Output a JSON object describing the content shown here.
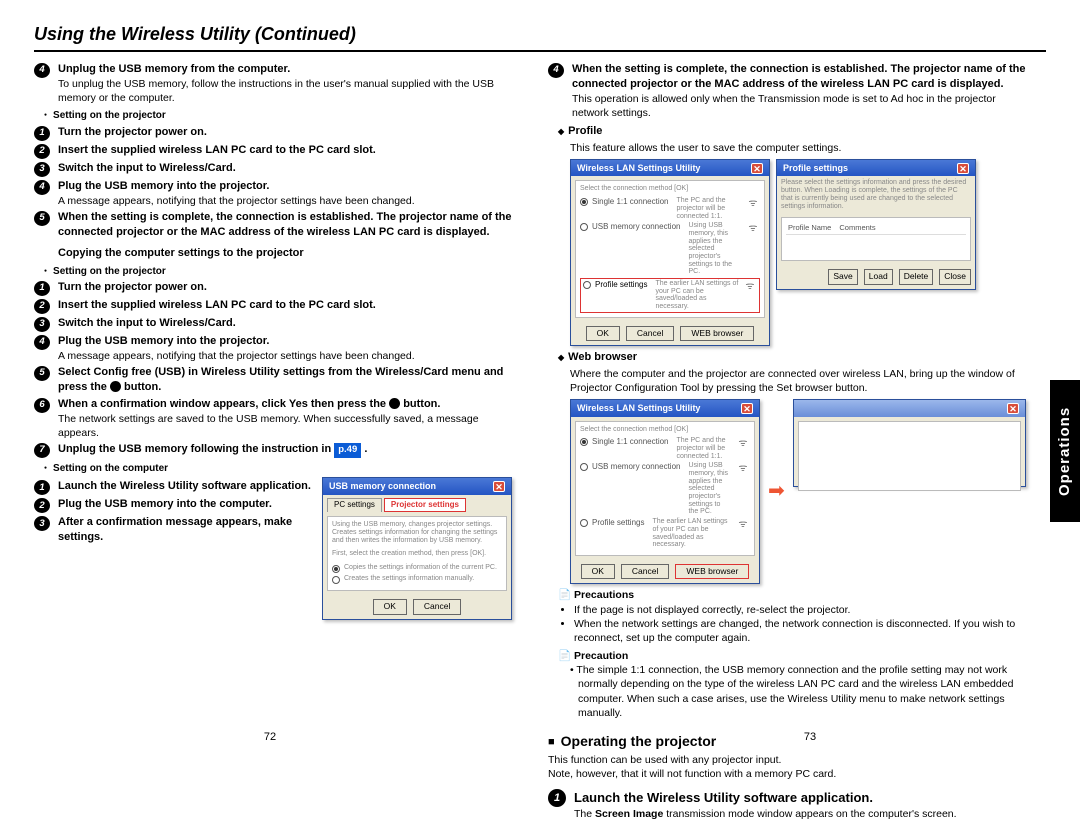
{
  "title": "Using the Wireless Utility (Continued)",
  "side_tab": "Operations",
  "page_left": "72",
  "page_right": "73",
  "left": {
    "s4_title": "Unplug the USB memory from the computer.",
    "s4_body": "To unplug the USB memory, follow the instructions in the user's manual supplied with the USB memory or the computer.",
    "setting_projector": "Setting on the projector",
    "p1": "Turn the projector power on.",
    "p2": "Insert the supplied wireless LAN PC card to the PC card slot.",
    "p3": "Switch the input to Wireless/Card.",
    "p4": "Plug the USB memory into the projector.",
    "p4_body": "A message appears, notifying that the projector settings have been changed.",
    "p5": "When the setting is complete, the connection is established. The projector name of the connected projector or the MAC address of the wireless LAN PC card is displayed.",
    "copy_title": "Copying the computer settings to the projector",
    "c5": "Select Config free (USB) in Wireless Utility settings from the Wireless/Card menu and press the",
    "c5_suffix": " button.",
    "c6": "When a confirmation window appears, click Yes then press the",
    "c6_suffix": " button.",
    "c6_body": "The network settings are saved to the USB memory. When successfully saved, a message appears.",
    "c7": "Unplug the USB memory following the instruction in ",
    "c7_link": "p.49",
    "c7_suffix": " .",
    "setting_computer": "Setting on the computer",
    "pc1": "Launch the Wireless Utility software application.",
    "pc2": "Plug the USB memory into the computer.",
    "pc3": "After a confirmation message appears, make settings.",
    "dlg_usb": {
      "title": "USB memory connection",
      "tab1": "PC settings",
      "tab2": "Projector settings",
      "desc1": "Using the USB memory, changes projector settings. Creates settings information for changing the settings and then writes the information by USB memory.",
      "desc2": "First, select the creation method, then press [OK].",
      "opt1": "Copies the settings information of the current PC.",
      "opt2": "Creates the settings information manually.",
      "ok": "OK",
      "cancel": "Cancel"
    }
  },
  "right": {
    "s4": "When the setting is complete, the connection is established. The projector name of the connected projector or the MAC address of the wireless LAN PC card is displayed.",
    "s4_body": "This operation is allowed only when the Transmission mode is set to Ad hoc in the projector network settings.",
    "profile_head": "Profile",
    "profile_body": "This feature allows the user to save the computer settings.",
    "dlg_wlan": {
      "title": "Wireless LAN Settings Utility",
      "hdr": "Select the connection method [OK]",
      "opt1": "Single 1:1 connection",
      "opt1d": "The PC and the projector will be connected 1:1.",
      "opt2": "USB memory connection",
      "opt2d": "Using USB memory, this applies the selected projector's settings to the PC.",
      "opt3": "Profile settings",
      "opt3d": "The earlier LAN settings of your PC can be saved/loaded as necessary.",
      "ok": "OK",
      "cancel": "Cancel",
      "web": "WEB browser"
    },
    "dlg_profile": {
      "title": "Profile settings",
      "desc": "Please select the settings information and press the desired button. When Loading is complete, the settings of the PC that is currently being used are changed to the selected settings information.",
      "col1": "Profile Name",
      "col2": "Comments",
      "save": "Save",
      "load": "Load",
      "delete": "Delete",
      "close": "Close"
    },
    "web_head": "Web browser",
    "web_body": "Where the computer and the projector are connected over wireless LAN, bring up the window of Projector Configuration Tool by pressing the Set browser button.",
    "precautions_label": "Precautions",
    "prec1": "If the page is not displayed correctly, re-select the projector.",
    "prec2": "When the network settings are changed, the network connection is disconnected. If you wish to reconnect, set up the computer again.",
    "precaution_single": "Precaution",
    "prec_single": "The simple 1:1 connection, the USB memory connection and the profile setting may not work normally depending on the type of the wireless LAN PC card and the wireless LAN embedded computer. When such a case arises, use the Wireless Utility menu to make network settings manually.",
    "op_head": "Operating the projector",
    "op_l1": "This function can be used with any projector input.",
    "op_l2": "Note, however, that it will not function with a memory PC card.",
    "bigstep": "Launch the Wireless Utility software application.",
    "big_sub_pre": "The ",
    "big_sub_bold": "Screen Image",
    "big_sub_post": " transmission mode window appears on the computer's screen."
  }
}
